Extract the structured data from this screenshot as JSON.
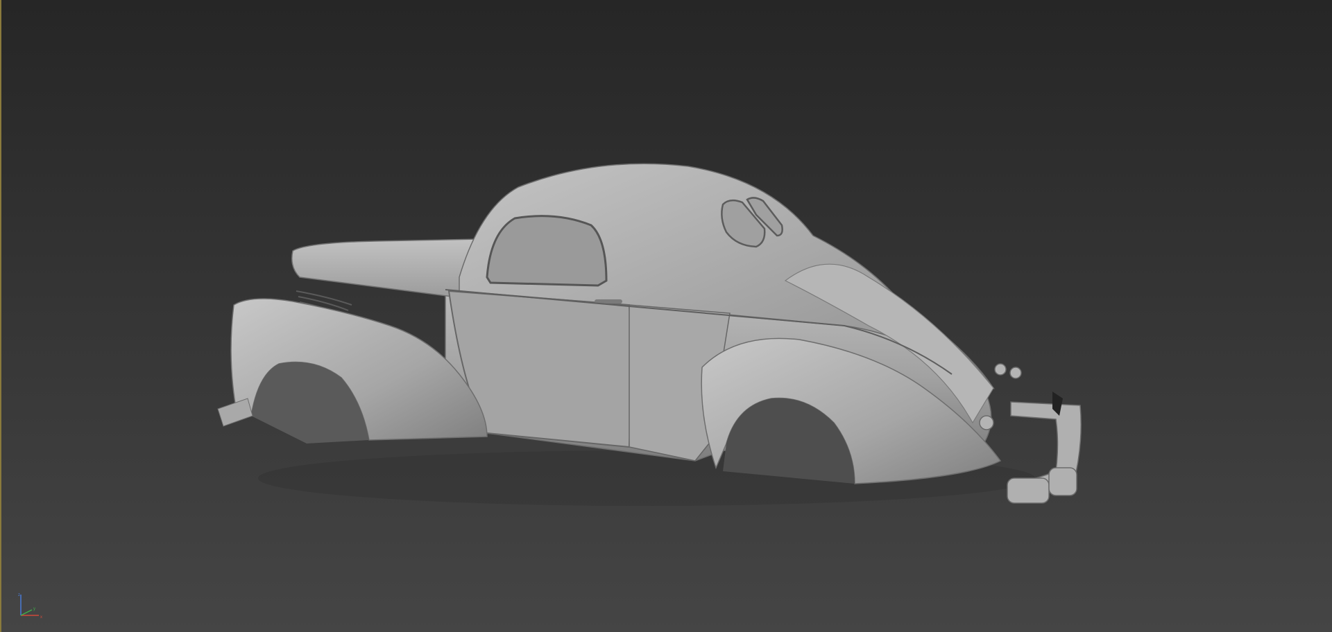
{
  "viewport": {
    "active_border_color": "#8a7a3c",
    "background_top": "#262626",
    "background_bottom": "#454545",
    "model": "car-body-shell",
    "shading": "clay-gray"
  },
  "axis_gizmo": {
    "axes": [
      "x",
      "y",
      "z"
    ],
    "colors": {
      "x": "#d04a3a",
      "y": "#3fae48",
      "z": "#4a7bd6"
    }
  }
}
